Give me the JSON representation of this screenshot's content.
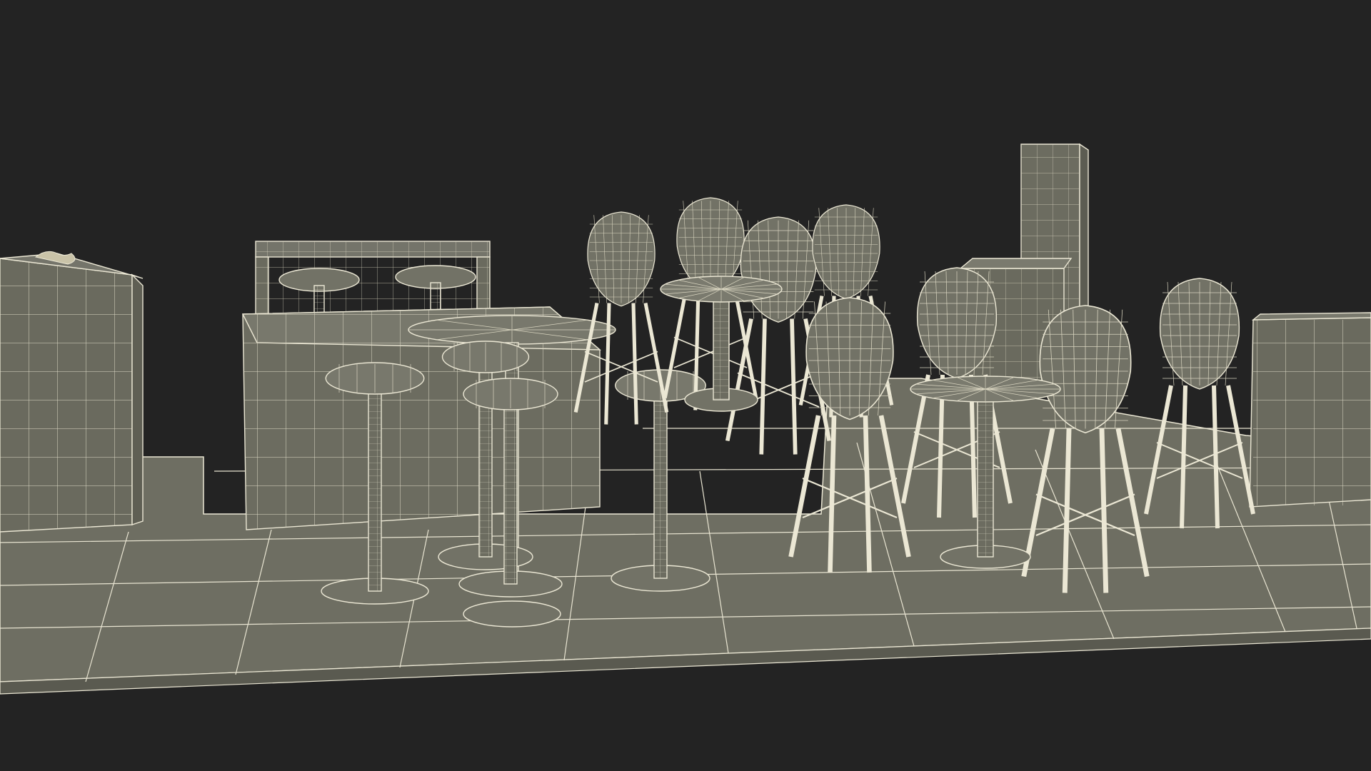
{
  "scene": {
    "colors": {
      "background": "#232323",
      "surface": "#6c6c60",
      "surface_light": "#7c7c6e",
      "surface_dark": "#5a5a50",
      "wire": "#e4e0cc"
    },
    "render_style": "wireframe-over-clay",
    "objects": [
      "floor-platform",
      "left-bar-counter",
      "back-bar-counter",
      "front-bar-counter",
      "bar-table",
      "bar-stool",
      "bistro-table",
      "shell-chair",
      "storage-cabinet",
      "tall-column",
      "right-counter"
    ]
  }
}
